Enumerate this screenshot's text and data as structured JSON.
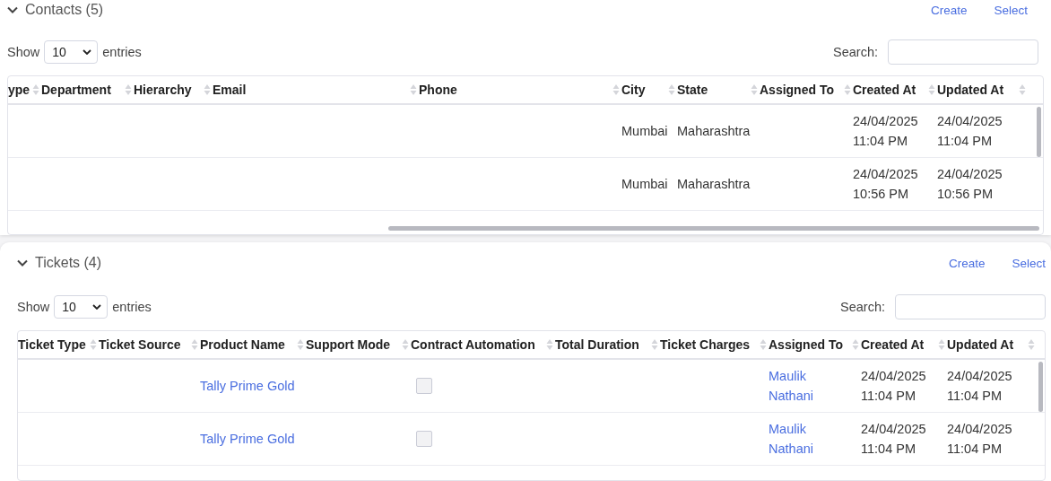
{
  "sections": [
    {
      "title": "Contacts (5)",
      "expanded": true,
      "actions": [
        "Create",
        "Select"
      ],
      "show_label": "Show",
      "page_size": "10",
      "entries_label": "entries",
      "search_label": "Search:",
      "columns": [
        {
          "label": "ype"
        },
        {
          "label": "Department"
        },
        {
          "label": "Hierarchy"
        },
        {
          "label": "Email"
        },
        {
          "label": "Phone"
        },
        {
          "label": "City"
        },
        {
          "label": "State"
        },
        {
          "label": "Assigned To"
        },
        {
          "label": "Created At"
        },
        {
          "label": "Updated At"
        }
      ],
      "rows": [
        [
          null,
          null,
          null,
          null,
          null,
          {
            "kind": "text",
            "text": "Mumbai"
          },
          {
            "kind": "text",
            "text": "Maharashtra"
          },
          null,
          {
            "kind": "text",
            "text": "24/04/2025 11:04 PM"
          },
          {
            "kind": "text",
            "text": "24/04/2025 11:04 PM"
          }
        ],
        [
          null,
          null,
          null,
          null,
          null,
          {
            "kind": "text",
            "text": "Mumbai"
          },
          {
            "kind": "text",
            "text": "Maharashtra"
          },
          null,
          {
            "kind": "text",
            "text": "24/04/2025 10:56 PM"
          },
          {
            "kind": "text",
            "text": "24/04/2025 10:56 PM"
          }
        ]
      ]
    },
    {
      "title": "Tickets (4)",
      "expanded": true,
      "actions": [
        "Create",
        "Select"
      ],
      "show_label": "Show",
      "page_size": "10",
      "entries_label": "entries",
      "search_label": "Search:",
      "columns": [
        {
          "label": "Ticket Type"
        },
        {
          "label": "Ticket Source"
        },
        {
          "label": "Product Name"
        },
        {
          "label": "Support Mode"
        },
        {
          "label": "Contract Automation"
        },
        {
          "label": "Total Duration"
        },
        {
          "label": "Ticket Charges"
        },
        {
          "label": "Assigned To"
        },
        {
          "label": "Created At"
        },
        {
          "label": "Updated At"
        }
      ],
      "rows": [
        [
          null,
          null,
          {
            "kind": "link",
            "text": "Tally Prime Gold"
          },
          null,
          {
            "kind": "checkbox",
            "checked": false
          },
          null,
          null,
          {
            "kind": "link",
            "text": "Maulik Nathani"
          },
          {
            "kind": "text",
            "text": "24/04/2025 11:04 PM"
          },
          {
            "kind": "text",
            "text": "24/04/2025 11:04 PM"
          }
        ],
        [
          null,
          null,
          {
            "kind": "link",
            "text": "Tally Prime Gold"
          },
          null,
          {
            "kind": "checkbox",
            "checked": false
          },
          null,
          null,
          {
            "kind": "link",
            "text": "Maulik Nathani"
          },
          {
            "kind": "text",
            "text": "24/04/2025 11:04 PM"
          },
          {
            "kind": "text",
            "text": "24/04/2025 11:04 PM"
          }
        ]
      ]
    }
  ]
}
